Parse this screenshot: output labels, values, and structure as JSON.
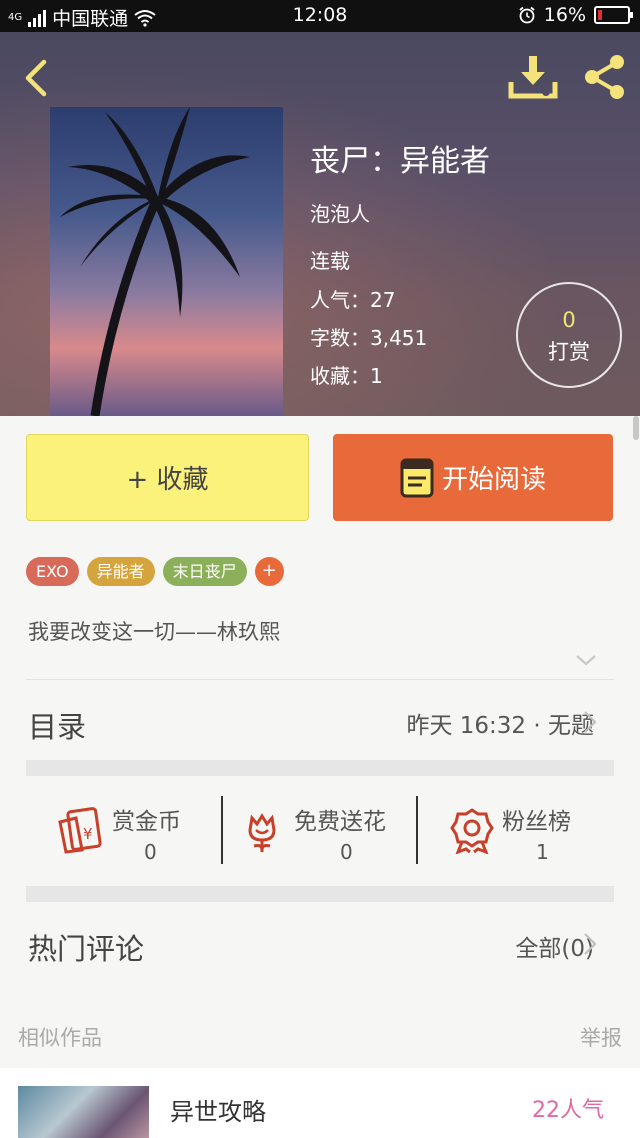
{
  "status_bar": {
    "network_type": "4G",
    "carrier": "中国联通",
    "time": "12:08",
    "battery_percent": "16%",
    "battery_level": 0.16,
    "icons": [
      "signal-icon",
      "wifi-icon",
      "alarm-icon",
      "battery-icon"
    ]
  },
  "header": {
    "icons": [
      "back-icon",
      "download-icon",
      "share-icon"
    ],
    "accent_color": "#f3e37a"
  },
  "book": {
    "title": "丧尸：异能者",
    "author": "泡泡人",
    "status": "连载",
    "popularity": "人气：27",
    "word_count": "字数：3,451",
    "favorites": "收藏：1",
    "tip_count": "0",
    "tip_label": "打赏"
  },
  "actions": {
    "favorite_label": "+ 收藏",
    "read_label": "开始阅读",
    "favorite_color": "#fbf27b",
    "read_color": "#e8693a"
  },
  "tags": [
    {
      "label": "EXO",
      "color": "#d86a5a"
    },
    {
      "label": "异能者",
      "color": "#d6a43c"
    },
    {
      "label": "末日丧尸",
      "color": "#8cb05a"
    }
  ],
  "tag_add_label": "+",
  "intro": "我要改变这一切——林玖熙",
  "catalog": {
    "title": "目录",
    "latest": "昨天 16:32 · 无题"
  },
  "rewards": [
    {
      "label": "赏金币",
      "value": "0",
      "icon": "red-envelope-icon"
    },
    {
      "label": "免费送花",
      "value": "0",
      "icon": "flower-icon"
    },
    {
      "label": "粉丝榜",
      "value": "1",
      "icon": "medal-icon"
    }
  ],
  "comments": {
    "title": "热门评论",
    "all": "全部(0)"
  },
  "similar": {
    "title": "相似作品",
    "report": "举报",
    "items": [
      {
        "name": "异世攻略",
        "popularity": "22人气"
      }
    ]
  }
}
